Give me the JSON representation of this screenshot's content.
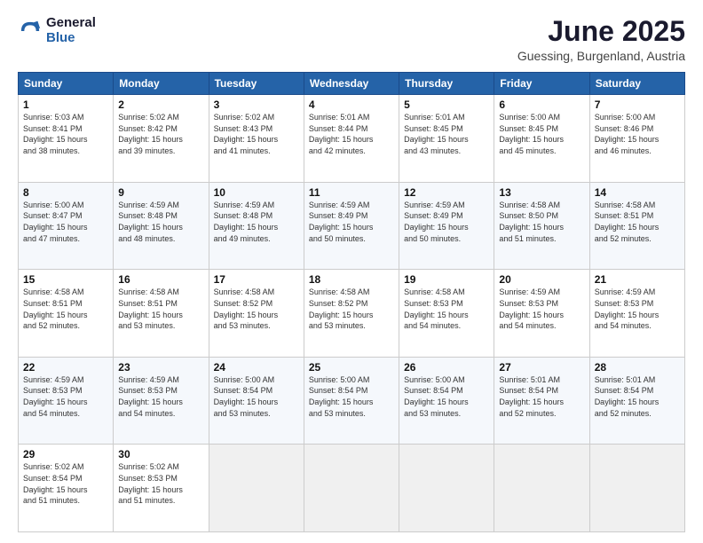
{
  "logo": {
    "text_general": "General",
    "text_blue": "Blue"
  },
  "header": {
    "title": "June 2025",
    "subtitle": "Guessing, Burgenland, Austria"
  },
  "calendar": {
    "weekdays": [
      "Sunday",
      "Monday",
      "Tuesday",
      "Wednesday",
      "Thursday",
      "Friday",
      "Saturday"
    ],
    "weeks": [
      [
        {
          "day": "1",
          "rise": "5:03 AM",
          "set": "8:41 PM",
          "daylight": "15 hours and 38 minutes."
        },
        {
          "day": "2",
          "rise": "5:02 AM",
          "set": "8:42 PM",
          "daylight": "15 hours and 39 minutes."
        },
        {
          "day": "3",
          "rise": "5:02 AM",
          "set": "8:43 PM",
          "daylight": "15 hours and 41 minutes."
        },
        {
          "day": "4",
          "rise": "5:01 AM",
          "set": "8:44 PM",
          "daylight": "15 hours and 42 minutes."
        },
        {
          "day": "5",
          "rise": "5:01 AM",
          "set": "8:45 PM",
          "daylight": "15 hours and 43 minutes."
        },
        {
          "day": "6",
          "rise": "5:00 AM",
          "set": "8:45 PM",
          "daylight": "15 hours and 45 minutes."
        },
        {
          "day": "7",
          "rise": "5:00 AM",
          "set": "8:46 PM",
          "daylight": "15 hours and 46 minutes."
        }
      ],
      [
        {
          "day": "8",
          "rise": "5:00 AM",
          "set": "8:47 PM",
          "daylight": "15 hours and 47 minutes."
        },
        {
          "day": "9",
          "rise": "4:59 AM",
          "set": "8:48 PM",
          "daylight": "15 hours and 48 minutes."
        },
        {
          "day": "10",
          "rise": "4:59 AM",
          "set": "8:48 PM",
          "daylight": "15 hours and 49 minutes."
        },
        {
          "day": "11",
          "rise": "4:59 AM",
          "set": "8:49 PM",
          "daylight": "15 hours and 50 minutes."
        },
        {
          "day": "12",
          "rise": "4:59 AM",
          "set": "8:49 PM",
          "daylight": "15 hours and 50 minutes."
        },
        {
          "day": "13",
          "rise": "4:58 AM",
          "set": "8:50 PM",
          "daylight": "15 hours and 51 minutes."
        },
        {
          "day": "14",
          "rise": "4:58 AM",
          "set": "8:51 PM",
          "daylight": "15 hours and 52 minutes."
        }
      ],
      [
        {
          "day": "15",
          "rise": "4:58 AM",
          "set": "8:51 PM",
          "daylight": "15 hours and 52 minutes."
        },
        {
          "day": "16",
          "rise": "4:58 AM",
          "set": "8:51 PM",
          "daylight": "15 hours and 53 minutes."
        },
        {
          "day": "17",
          "rise": "4:58 AM",
          "set": "8:52 PM",
          "daylight": "15 hours and 53 minutes."
        },
        {
          "day": "18",
          "rise": "4:58 AM",
          "set": "8:52 PM",
          "daylight": "15 hours and 53 minutes."
        },
        {
          "day": "19",
          "rise": "4:58 AM",
          "set": "8:53 PM",
          "daylight": "15 hours and 54 minutes."
        },
        {
          "day": "20",
          "rise": "4:59 AM",
          "set": "8:53 PM",
          "daylight": "15 hours and 54 minutes."
        },
        {
          "day": "21",
          "rise": "4:59 AM",
          "set": "8:53 PM",
          "daylight": "15 hours and 54 minutes."
        }
      ],
      [
        {
          "day": "22",
          "rise": "4:59 AM",
          "set": "8:53 PM",
          "daylight": "15 hours and 54 minutes."
        },
        {
          "day": "23",
          "rise": "4:59 AM",
          "set": "8:53 PM",
          "daylight": "15 hours and 54 minutes."
        },
        {
          "day": "24",
          "rise": "5:00 AM",
          "set": "8:54 PM",
          "daylight": "15 hours and 53 minutes."
        },
        {
          "day": "25",
          "rise": "5:00 AM",
          "set": "8:54 PM",
          "daylight": "15 hours and 53 minutes."
        },
        {
          "day": "26",
          "rise": "5:00 AM",
          "set": "8:54 PM",
          "daylight": "15 hours and 53 minutes."
        },
        {
          "day": "27",
          "rise": "5:01 AM",
          "set": "8:54 PM",
          "daylight": "15 hours and 52 minutes."
        },
        {
          "day": "28",
          "rise": "5:01 AM",
          "set": "8:54 PM",
          "daylight": "15 hours and 52 minutes."
        }
      ],
      [
        {
          "day": "29",
          "rise": "5:02 AM",
          "set": "8:54 PM",
          "daylight": "15 hours and 51 minutes."
        },
        {
          "day": "30",
          "rise": "5:02 AM",
          "set": "8:53 PM",
          "daylight": "15 hours and 51 minutes."
        },
        null,
        null,
        null,
        null,
        null
      ]
    ]
  }
}
